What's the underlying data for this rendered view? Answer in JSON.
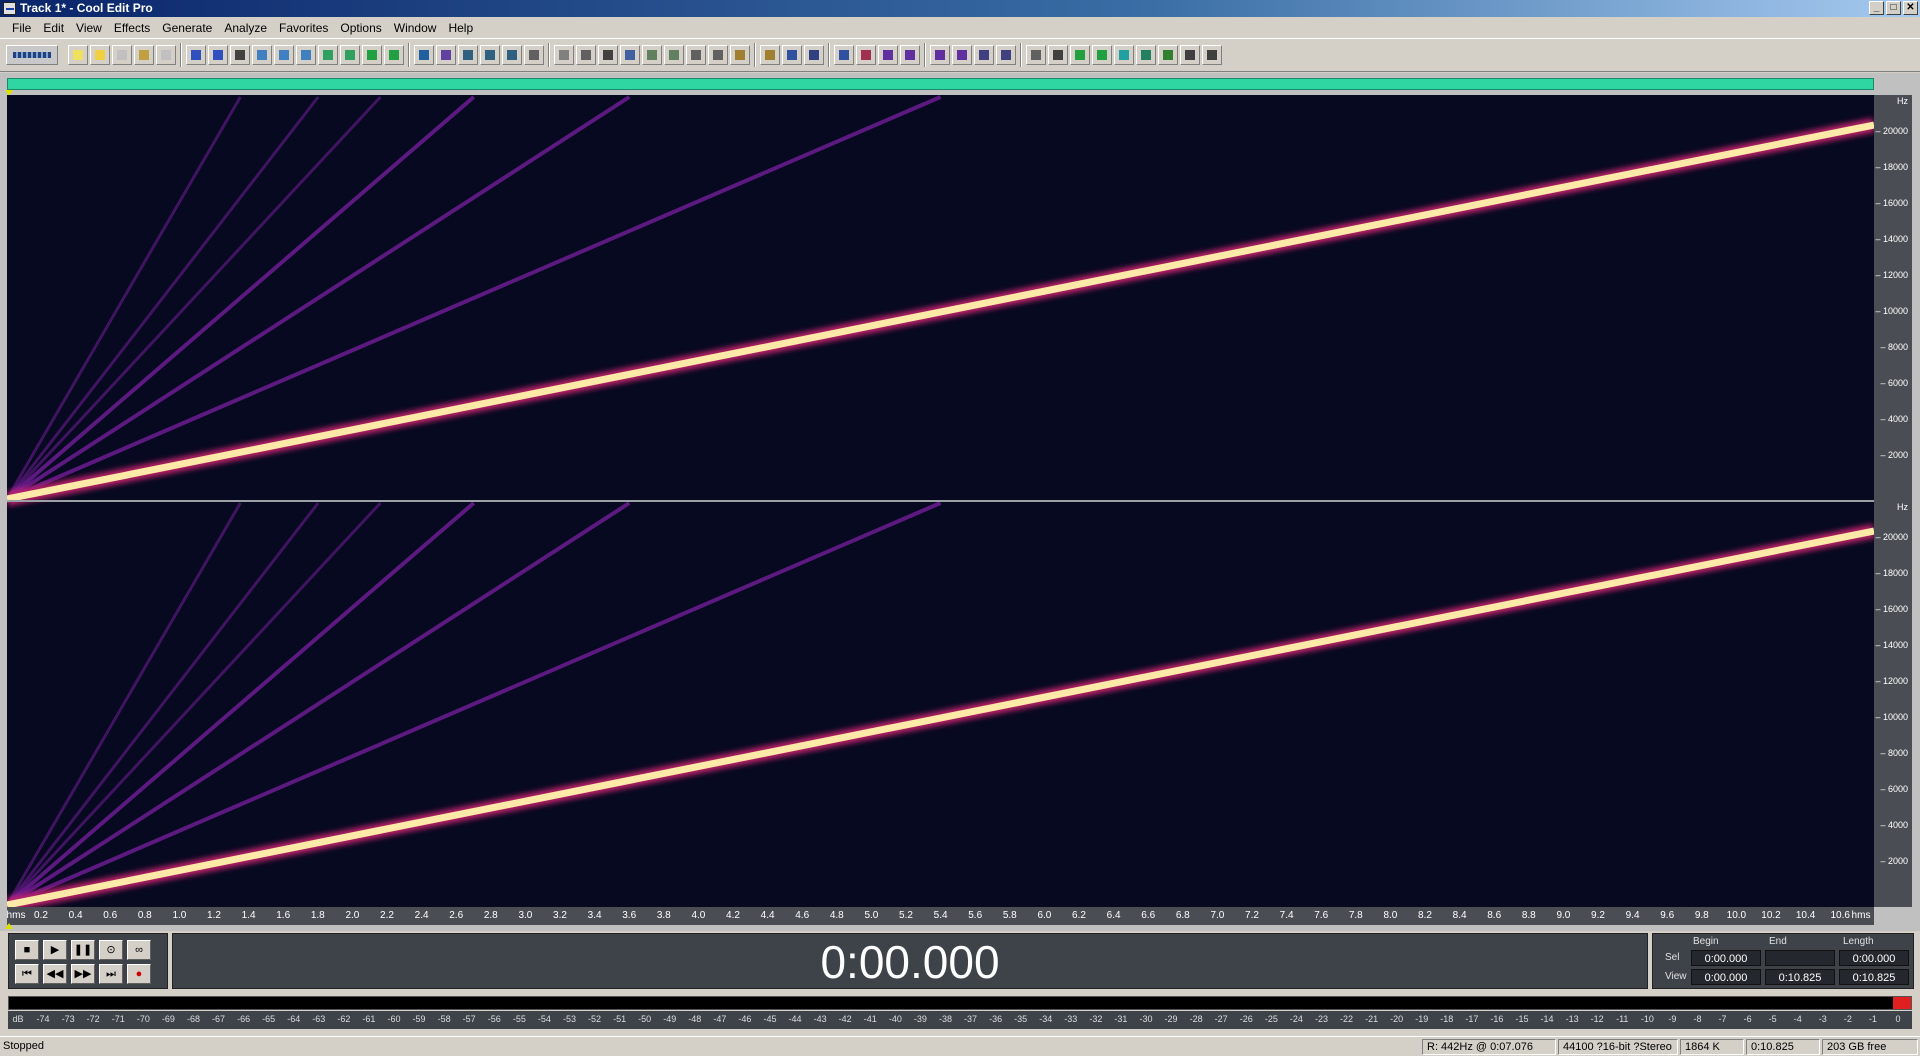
{
  "window": {
    "title": "Track 1* - Cool Edit Pro",
    "controls": [
      "_",
      "□",
      "✕"
    ]
  },
  "menu": [
    "File",
    "Edit",
    "View",
    "Effects",
    "Generate",
    "Analyze",
    "Favorites",
    "Options",
    "Window",
    "Help"
  ],
  "spectral": {
    "freq_unit": "Hz",
    "freq_ticks": [
      "20000",
      "18000",
      "16000",
      "14000",
      "12000",
      "10000",
      "8000",
      "6000",
      "4000",
      "2000"
    ],
    "time_start_label": "hms",
    "time_end_label": "hms",
    "time_ticks": [
      "0.2",
      "0.4",
      "0.6",
      "0.8",
      "1.0",
      "1.2",
      "1.4",
      "1.6",
      "1.8",
      "2.0",
      "2.2",
      "2.4",
      "2.6",
      "2.8",
      "3.0",
      "3.2",
      "3.4",
      "3.6",
      "3.8",
      "4.0",
      "4.2",
      "4.4",
      "4.6",
      "4.8",
      "5.0",
      "5.2",
      "5.4",
      "5.6",
      "5.8",
      "6.0",
      "6.2",
      "6.4",
      "6.6",
      "6.8",
      "7.0",
      "7.2",
      "7.4",
      "7.6",
      "7.8",
      "8.0",
      "8.2",
      "8.4",
      "8.6",
      "8.8",
      "9.0",
      "9.2",
      "9.4",
      "9.6",
      "9.8",
      "10.0",
      "10.2",
      "10.4",
      "10.6"
    ],
    "overview_color": "#2fd6a2",
    "sweep_color": "#ffe9a8",
    "harmonic_color": "#7a1fa0"
  },
  "transport": {
    "buttons": [
      "stop",
      "play",
      "pause",
      "play-from-cursor",
      "loop",
      "go-to-start",
      "rewind",
      "fast-forward",
      "go-to-end",
      "record"
    ]
  },
  "time_display": "0:00.000",
  "selection": {
    "headers": [
      "Begin",
      "End",
      "Length"
    ],
    "sel_label": "Sel",
    "view_label": "View",
    "sel": [
      "0:00.000",
      "",
      "0:00.000"
    ],
    "view": [
      "0:00.000",
      "0:10.825",
      "0:10.825"
    ]
  },
  "meter": {
    "labels": [
      "dB",
      "-74",
      "-73",
      "-72",
      "-71",
      "-70",
      "-69",
      "-68",
      "-67",
      "-66",
      "-65",
      "-64",
      "-63",
      "-62",
      "-61",
      "-60",
      "-59",
      "-58",
      "-57",
      "-56",
      "-55",
      "-54",
      "-53",
      "-52",
      "-51",
      "-50",
      "-49",
      "-48",
      "-47",
      "-46",
      "-45",
      "-44",
      "-43",
      "-42",
      "-41",
      "-40",
      "-39",
      "-38",
      "-37",
      "-36",
      "-35",
      "-34",
      "-33",
      "-32",
      "-31",
      "-30",
      "-29",
      "-28",
      "-27",
      "-26",
      "-25",
      "-24",
      "-23",
      "-22",
      "-21",
      "-20",
      "-19",
      "-18",
      "-17",
      "-16",
      "-15",
      "-14",
      "-13",
      "-12",
      "-11",
      "-10",
      "-9",
      "-8",
      "-7",
      "-6",
      "-5",
      "-4",
      "-3",
      "-2",
      "-1",
      "0"
    ]
  },
  "status": {
    "state": "Stopped",
    "cursor_info": "R: 442Hz @  0:07.076",
    "format": "44100 ?16-bit ?Stereo",
    "size": "1864 K",
    "duration": "0:10.825",
    "free": "203 GB free"
  }
}
